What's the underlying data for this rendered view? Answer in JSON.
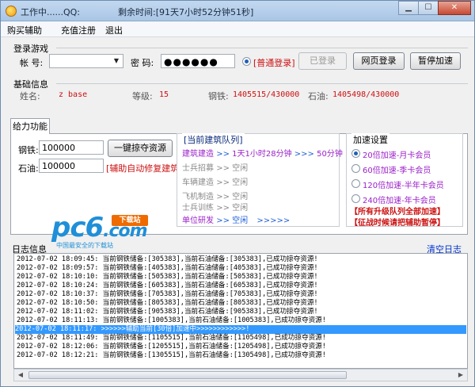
{
  "window": {
    "title": "工作中......QQ:",
    "timer": "剩余时间:[91天7小时52分钟51秒]"
  },
  "menu": [
    "购买辅助",
    "充值注册",
    "退出"
  ],
  "login": {
    "section_label": "登录游戏",
    "account_label": "帐  号:",
    "account_value": "",
    "password_label": "密  码:",
    "password_value": "●●●●●●",
    "mode_label": "[普通登录]",
    "btn_logged_in": "已登录",
    "btn_web_login": "网页登录",
    "btn_pause": "暂停加速"
  },
  "basic": {
    "section_label": "基础信息",
    "name_label": "姓名:",
    "name_value": "z base",
    "level_label": "等级:",
    "level_value": "15",
    "steel_label": "钢铁:",
    "steel_value": "1405515/430000",
    "oil_label": "石油:",
    "oil_value": "1405498/430000"
  },
  "tab": {
    "label": "给力功能"
  },
  "resources": {
    "steel_label": "钢铁:",
    "steel_value": "100000",
    "oil_label": "石油:",
    "oil_value": "100000",
    "plunder_btn": "一键掠夺资源",
    "auto_repair": "[辅助自动修复建筑]"
  },
  "queue": {
    "title": "[当前建筑队列]",
    "build_name": "建筑建造",
    "build_arrow1": ">>",
    "build_time": "1天1小时28分钟",
    "build_arrow2": ">>>",
    "build_remain": "50分钟",
    "rows": [
      {
        "name": "士兵招募",
        "arrow": ">>",
        "status": "空闲"
      },
      {
        "name": "车辆建造",
        "arrow": ">>",
        "status": "空闲"
      },
      {
        "name": "飞机制造",
        "arrow": ">>",
        "status": "空闲"
      },
      {
        "name": "士兵训练",
        "arrow": ">>",
        "status": "空闲"
      }
    ],
    "research_name": "单位研发",
    "research_arrow": ">>",
    "research_status": "空闲",
    "research_tail": ">>>>>"
  },
  "speed": {
    "title": "加速设置",
    "options": [
      "20倍加速-月卡会员",
      "60倍加速-季卡会员",
      "120倍加速-半年卡会员",
      "240倍加速-年卡会员"
    ],
    "selected": 0,
    "note1": "【所有升级队列全部加速】",
    "note2": "【征战时候请把辅助暂停】"
  },
  "logo": {
    "text": "pc6",
    "suffix": ".com",
    "badge": "下载站",
    "sub": "中国最安全的下载站"
  },
  "log": {
    "title": "日志信息",
    "clear": "清空日志",
    "selected_index": 10,
    "lines": [
      "2012-07-02 18:09:45: 当前钢铁储备:[305383],当前石油储备:[305383],已成功掠夺资源!",
      "2012-07-02 18:09:57: 当前钢铁储备:[405383],当前石油储备:[405383],已成功掠夺资源!",
      "2012-07-02 18:10:10: 当前钢铁储备:[505383],当前石油储备:[505383],已成功掠夺资源!",
      "2012-07-02 18:10:24: 当前钢铁储备:[605383],当前石油储备:[605383],已成功掠夺资源!",
      "2012-07-02 18:10:37: 当前钢铁储备:[705383],当前石油储备:[705383],已成功掠夺资源!",
      "2012-07-02 18:10:50: 当前钢铁储备:[805383],当前石油储备:[805383],已成功掠夺资源!",
      "2012-07-02 18:11:02: 当前钢铁储备:[905383],当前石油储备:[905383],已成功掠夺资源!",
      "2012-07-02 18:11:13: 当前钢铁储备:[1005383],当前石油储备:[1005383],已成功掠夺资源!",
      "2012-07-02 18:11:17: >>>>>>辅助当前[30倍]加速中>>>>>>>>>>>>!",
      "2012-07-02 18:11:49: 当前钢铁储备:[1105515],当前石油储备:[1105498],已成功掠夺资源!",
      "2012-07-02 18:12:06: 当前钢铁储备:[1205515],当前石油储备:[1205498],已成功掠夺资源!",
      "2012-07-02 18:12:21: 当前钢铁储备:[1305515],当前石油储备:[1305498],已成功掠夺资源!"
    ]
  }
}
